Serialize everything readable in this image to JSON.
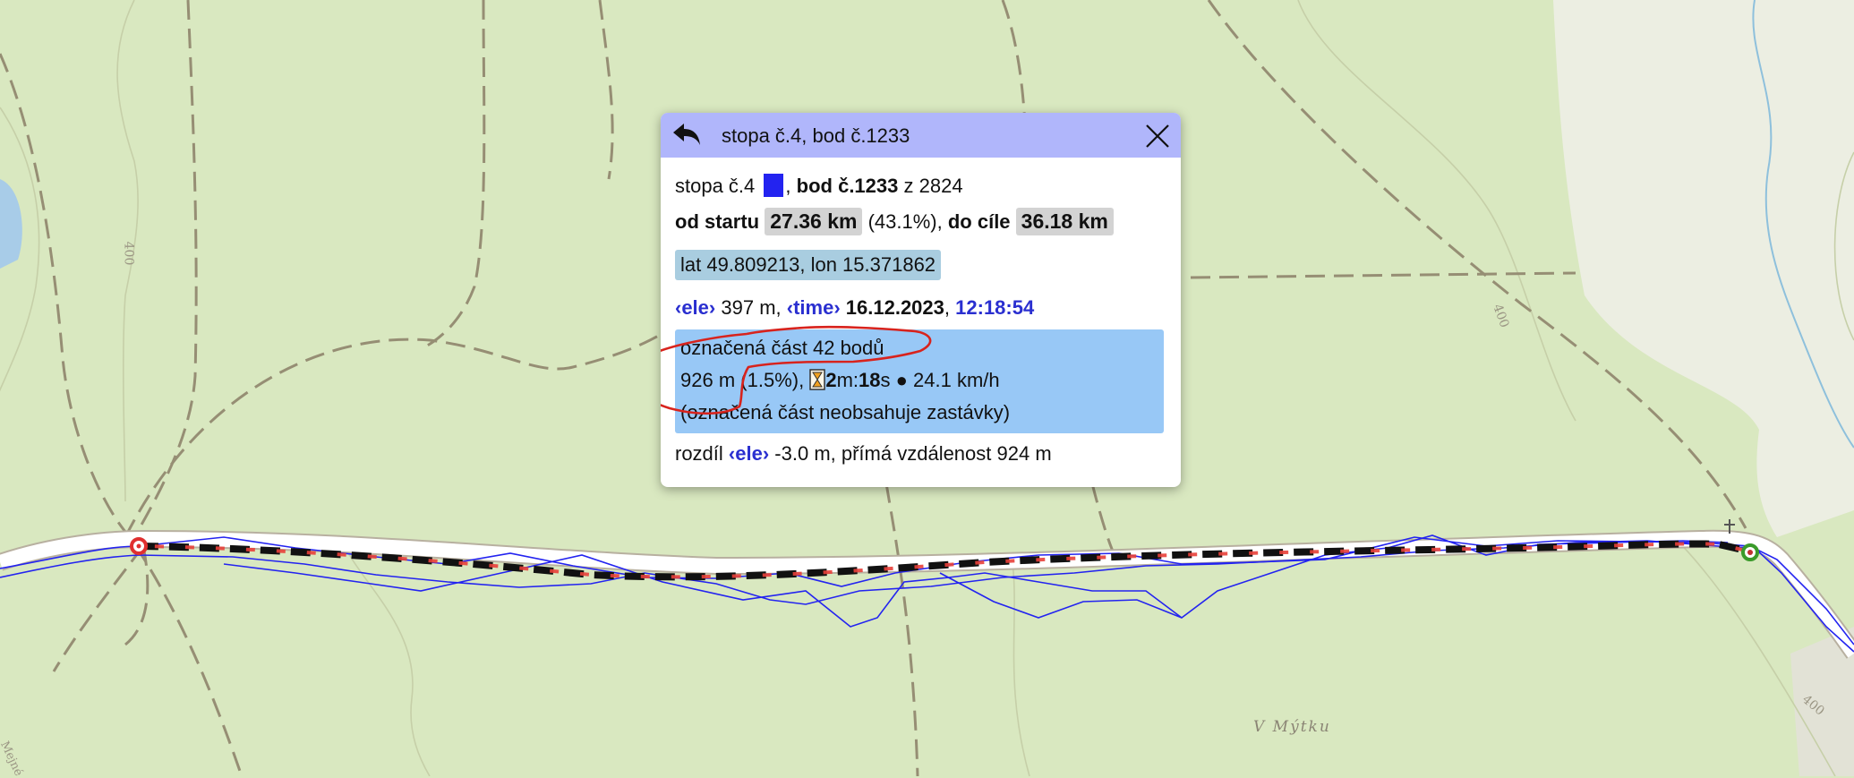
{
  "map": {
    "contour_labels": [
      "400",
      "400",
      "400"
    ],
    "place_label": "V Mýtku",
    "edge_label": "Mejné",
    "track_color": "#2323f0",
    "selection_color": "#e8403a",
    "start_marker_color": "#e03030",
    "end_marker_color": "#3a9a2a"
  },
  "popup": {
    "title": "stopa č.4, bod č.1233",
    "back_icon": "back-arrow-icon",
    "close_icon": "close-icon",
    "track_line": {
      "track_label": "stopa č.4",
      "comma": ",",
      "point_label": "bod č.1233",
      "of_total": "z 2824"
    },
    "distance_line": {
      "from_start_label": "od startu",
      "from_start_value": "27.36 km",
      "from_start_percent": "(43.1%),",
      "to_finish_label": "do cíle",
      "to_finish_value": "36.18 km"
    },
    "coords": "lat 49.809213, lon 15.371862",
    "ele_line": {
      "ele_tag": "‹ele›",
      "ele_value": "397 m,",
      "time_tag": "‹time›",
      "date": "16.12.2023",
      "comma": ",",
      "time": "12:18:54"
    },
    "selection": {
      "line1": "označená část 42 bodů",
      "distance": "926 m",
      "percent": "(1.5%),",
      "duration_min": "2",
      "duration_min_unit": "m:",
      "duration_sec": "18",
      "duration_sec_unit": "s",
      "speed": "● 24.1 km/h",
      "note": "(označená část neobsahuje zastávky)"
    },
    "diff_line": {
      "label": "rozdíl",
      "ele_tag": "‹ele›",
      "rest": "-3.0 m, přímá vzdálenost 924 m"
    }
  }
}
